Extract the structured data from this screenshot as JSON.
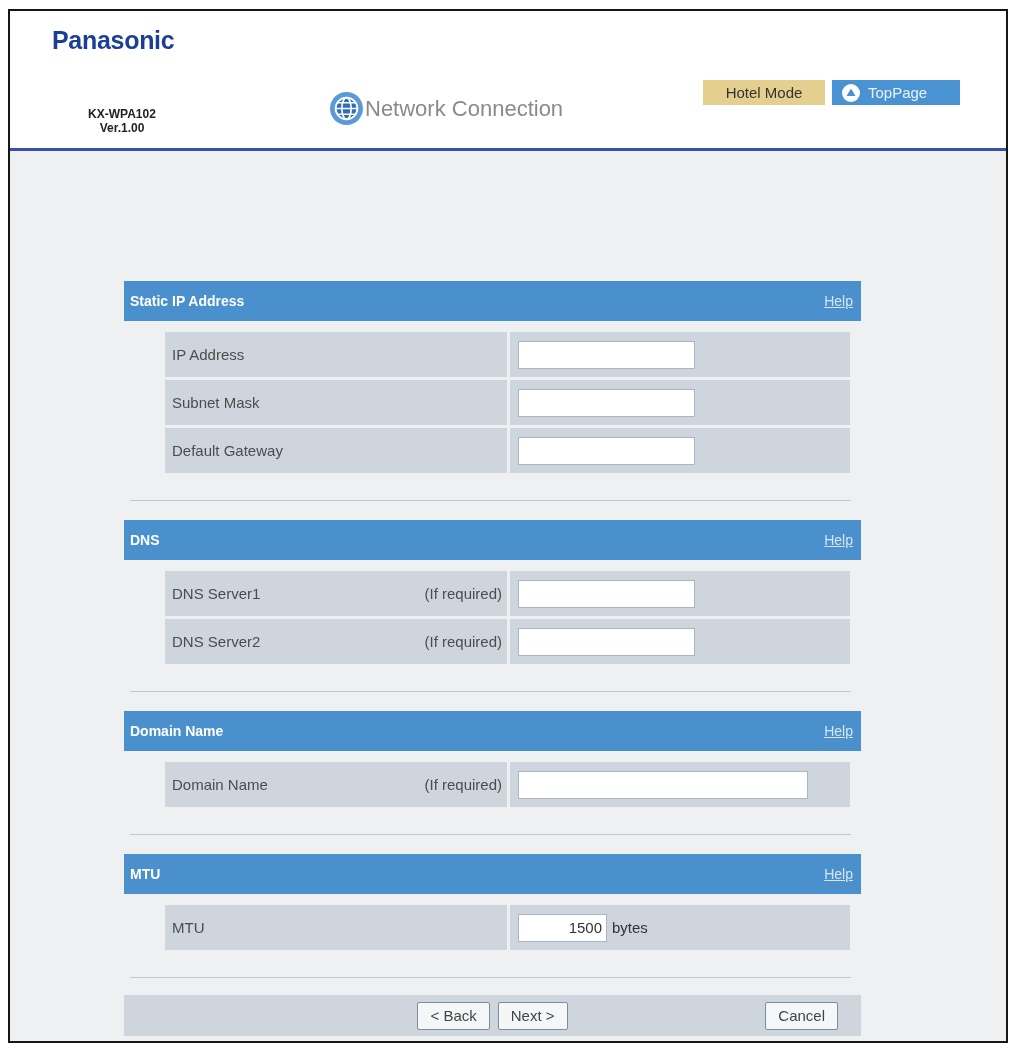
{
  "header": {
    "logo": "Panasonic",
    "model": "KX-WPA102",
    "version": "Ver.1.00",
    "title": "Network Connection",
    "buttons": [
      {
        "label": "Hotel Mode",
        "kind": "mode"
      },
      {
        "label": "TopPage",
        "kind": "home"
      }
    ]
  },
  "sections": [
    {
      "title": "Static IP Address",
      "help": "Help",
      "fields": [
        {
          "label": "IP Address",
          "kind": "normal"
        },
        {
          "label": "Subnet Mask",
          "kind": "normal"
        },
        {
          "label": "Default Gateway",
          "kind": "normal"
        }
      ]
    },
    {
      "title": "DNS",
      "help": "Help",
      "fields": [
        {
          "label": "DNS Server1",
          "note": "(If required)",
          "kind": "normal"
        },
        {
          "label": "DNS Server2",
          "note": "(If required)",
          "kind": "normal"
        }
      ]
    },
    {
      "title": "Domain Name",
      "help": "Help",
      "fields": [
        {
          "label": "Domain Name",
          "note": "(If required)",
          "kind": "wide"
        }
      ]
    },
    {
      "title": "MTU",
      "help": "Help",
      "fields": [
        {
          "label": "MTU",
          "value": "1500",
          "unit": "bytes",
          "kind": "short"
        }
      ]
    }
  ],
  "footer": {
    "buttons": [
      {
        "label": "< Back",
        "kind": "nav"
      },
      {
        "label": "Next >",
        "kind": "nav"
      },
      {
        "label": "Cancel",
        "kind": "cancel"
      }
    ]
  }
}
